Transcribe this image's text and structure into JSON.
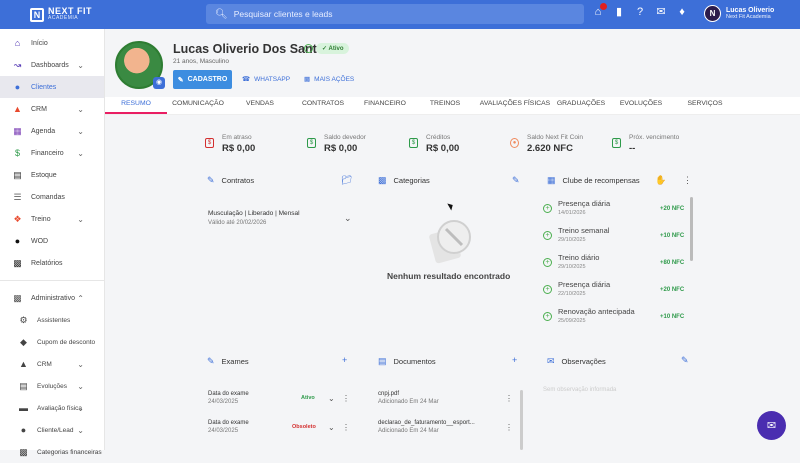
{
  "brand": {
    "name": "NEXT FIT",
    "sub": "ACADEMIA"
  },
  "search": {
    "placeholder": "Pesquisar clientes e leads"
  },
  "user": {
    "initial": "N",
    "name": "Lucas Oliverio",
    "org": "Next Fit Academia"
  },
  "sidebar": {
    "items": [
      {
        "label": "Início",
        "icon": "home-icon"
      },
      {
        "label": "Dashboards",
        "icon": "chart-icon"
      },
      {
        "label": "Clientes",
        "icon": "users-icon"
      },
      {
        "label": "CRM",
        "icon": "crm-icon"
      },
      {
        "label": "Agenda",
        "icon": "calendar-icon"
      },
      {
        "label": "Financeiro",
        "icon": "money-icon"
      },
      {
        "label": "Estoque",
        "icon": "cart-icon"
      },
      {
        "label": "Comandas",
        "icon": "receipt-icon"
      },
      {
        "label": "Treino",
        "icon": "dumbbell-icon"
      },
      {
        "label": "WOD",
        "icon": "kettlebell-icon"
      },
      {
        "label": "Relatórios",
        "icon": "report-icon"
      }
    ],
    "admin": {
      "label": "Administrativo",
      "items": [
        {
          "label": "Assistentes"
        },
        {
          "label": "Cupom de desconto"
        },
        {
          "label": "CRM"
        },
        {
          "label": "Evoluções"
        },
        {
          "label": "Avaliação física"
        },
        {
          "label": "Cliente/Lead"
        },
        {
          "label": "Categorias financeiras"
        }
      ]
    }
  },
  "profile": {
    "name": "Lucas Oliverio Dos Santos",
    "status": "Ativo",
    "subtitle": "21 anos, Masculino",
    "cadastro_label": "CADASTRO",
    "whatsapp_label": "WHATSAPP",
    "more_label": "MAIS AÇÕES"
  },
  "tabs": [
    "RESUMO",
    "COMUNICAÇÃO",
    "VENDAS",
    "CONTRATOS",
    "FINANCEIRO",
    "TREINOS",
    "AVALIAÇÕES FÍSICAS",
    "GRADUAÇÕES",
    "EVOLUÇÕES",
    "SERVIÇOS"
  ],
  "stats": [
    {
      "label": "Em atraso",
      "value": "R$ 0,00"
    },
    {
      "label": "Saldo devedor",
      "value": "R$ 0,00"
    },
    {
      "label": "Créditos",
      "value": "R$ 0,00"
    },
    {
      "label": "Saldo Next Fit Coin",
      "value": "2.620 NFC"
    },
    {
      "label": "Próx. vencimento",
      "value": "--"
    }
  ],
  "sections": {
    "contratos": "Contratos",
    "categorias": "Categorias",
    "clube": "Clube de recompensas",
    "exames": "Exames",
    "documentos": "Documentos",
    "observacoes": "Observações"
  },
  "contract": {
    "title": "Musculação | Liberado | Mensal",
    "valid": "Válido até 20/02/2026"
  },
  "empty": "Nenhum resultado encontrado",
  "rewards": [
    {
      "name": "Presença diária",
      "date": "14/01/2026",
      "points": "+20 NFC"
    },
    {
      "name": "Treino semanal",
      "date": "29/10/2025",
      "points": "+10 NFC"
    },
    {
      "name": "Treino diário",
      "date": "29/10/2025",
      "points": "+80 NFC"
    },
    {
      "name": "Presença diária",
      "date": "22/10/2025",
      "points": "+20 NFC"
    },
    {
      "name": "Renovação antecipada",
      "date": "25/09/2025",
      "points": "+10 NFC"
    }
  ],
  "exams": [
    {
      "label": "Data do exame",
      "date": "24/03/2025",
      "status": "Ativo",
      "status_color": "#2e9a4a"
    },
    {
      "label": "Data do exame",
      "date": "24/03/2025",
      "status": "Obsoleto",
      "status_color": "#d32f2f"
    }
  ],
  "documents": [
    {
      "name": "cnpj.pdf",
      "added": "Adicionado Em 24 Mar"
    },
    {
      "name": "declarao_de_faturamento__esport...",
      "added": "Adicionado Em 24 Mar"
    }
  ],
  "observations": "Sem observação informada",
  "colors": {
    "primary": "#3d6fd8",
    "accent": "#e91e63",
    "success": "#2e9a4a",
    "danger": "#d32f2f"
  }
}
